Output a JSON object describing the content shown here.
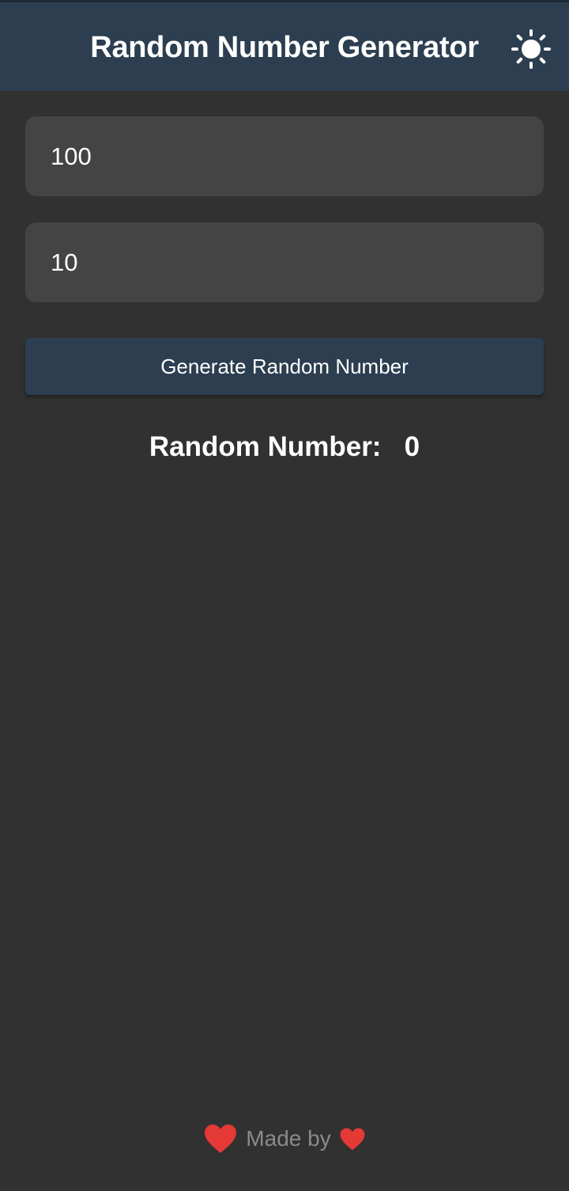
{
  "header": {
    "title": "Random Number Generator",
    "theme_icon": "sun-icon"
  },
  "form": {
    "max_value": "100",
    "min_value": "10",
    "generate_label": "Generate Random Number"
  },
  "result": {
    "label": "Random Number:",
    "value": "0"
  },
  "footer": {
    "text": "Made by",
    "icons": [
      "heart-icon",
      "heart-icon"
    ]
  },
  "colors": {
    "background": "#313131",
    "header": "#2c3e50",
    "input_background": "#444444",
    "button": "#2c3e50",
    "heart": "#e53935",
    "footer_text": "#8a8a8a"
  }
}
